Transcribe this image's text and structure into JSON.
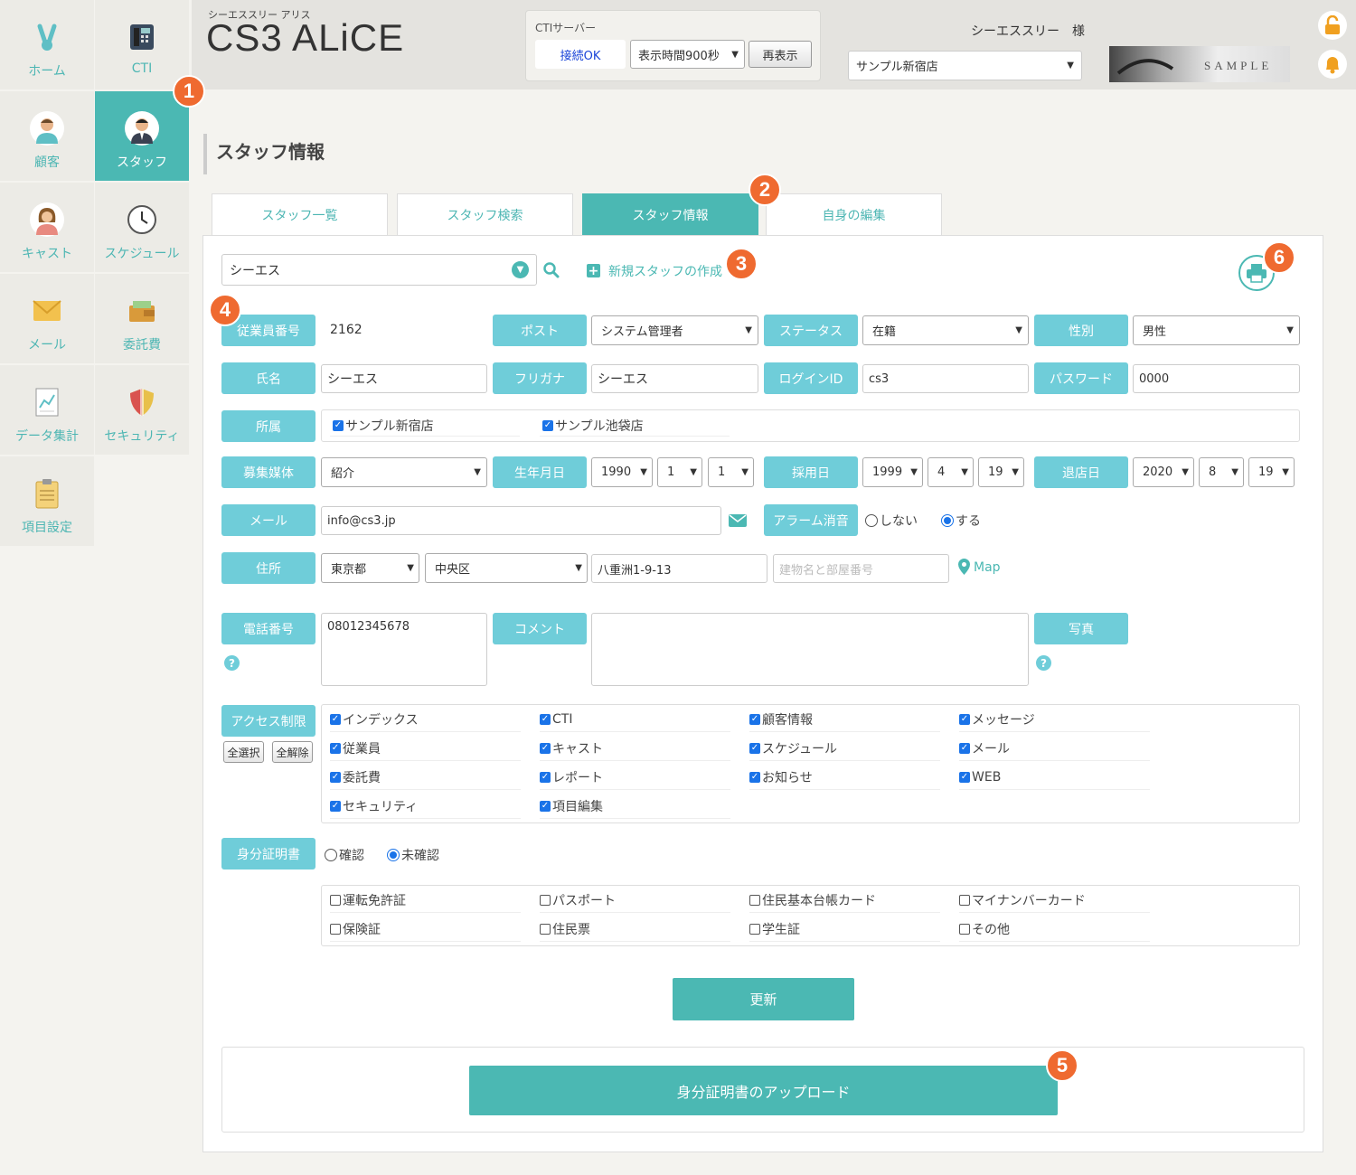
{
  "app": {
    "subtitle": "シーエススリー アリス",
    "title": "CS3 ALiCE"
  },
  "header": {
    "cti_label": "CTIサーバー",
    "cti_status": "接続OK",
    "display_time": "表示時間900秒",
    "refresh_label": "再表示",
    "user_name": "シーエススリー　様",
    "store": "サンプル新宿店"
  },
  "sidebar": {
    "items": [
      {
        "label": "ホーム"
      },
      {
        "label": "CTI"
      },
      {
        "label": "顧客"
      },
      {
        "label": "スタッフ"
      },
      {
        "label": "キャスト"
      },
      {
        "label": "スケジュール"
      },
      {
        "label": "メール"
      },
      {
        "label": "委託費"
      },
      {
        "label": "データ集計"
      },
      {
        "label": "セキュリティ"
      },
      {
        "label": "項目設定"
      }
    ]
  },
  "badges": [
    "1",
    "2",
    "3",
    "4",
    "5",
    "6"
  ],
  "page_title": "スタッフ情報",
  "tabs": [
    "スタッフ一覧",
    "スタッフ検索",
    "スタッフ情報",
    "自身の編集"
  ],
  "search": {
    "value": "シーエス",
    "new_staff": "新規スタッフの作成"
  },
  "form": {
    "employee_no_label": "従業員番号",
    "employee_no": "2162",
    "post_label": "ポスト",
    "post": "システム管理者",
    "status_label": "ステータス",
    "status": "在籍",
    "gender_label": "性別",
    "gender": "男性",
    "name_label": "氏名",
    "name": "シーエス",
    "furigana_label": "フリガナ",
    "furigana": "シーエス",
    "login_label": "ログインID",
    "login": "cs3",
    "password_label": "パスワード",
    "password": "0000",
    "affiliation_label": "所属",
    "aff1": "サンプル新宿店",
    "aff2": "サンプル池袋店",
    "media_label": "募集媒体",
    "media": "紹介",
    "birth_label": "生年月日",
    "birth_y": "1990",
    "birth_m": "1",
    "birth_d": "1",
    "hire_label": "採用日",
    "hire_y": "1999",
    "hire_m": "4",
    "hire_d": "19",
    "leave_label": "退店日",
    "leave_y": "2020",
    "leave_m": "8",
    "leave_d": "19",
    "mail_label": "メール",
    "mail": "info@cs3.jp",
    "alarm_label": "アラーム消音",
    "alarm_no": "しない",
    "alarm_yes": "する",
    "address_label": "住所",
    "pref": "東京都",
    "ward": "中央区",
    "street": "八重洲1-9-13",
    "building_placeholder": "建物名と部屋番号",
    "map": "Map",
    "phone_label": "電話番号",
    "phone": "08012345678",
    "comment_label": "コメント",
    "photo_label": "写真",
    "access_label": "アクセス制限",
    "select_all": "全選択",
    "deselect_all": "全解除",
    "access": [
      "インデックス",
      "CTI",
      "顧客情報",
      "メッセージ",
      "従業員",
      "キャスト",
      "スケジュール",
      "メール",
      "委託費",
      "レポート",
      "お知らせ",
      "WEB",
      "セキュリティ",
      "項目編集"
    ],
    "id_label": "身分証明書",
    "id_confirmed": "確認",
    "id_unconfirmed": "未確認",
    "id_docs": [
      "運転免許証",
      "パスポート",
      "住民基本台帳カード",
      "マイナンバーカード",
      "保険証",
      "住民票",
      "学生証",
      "その他"
    ],
    "update": "更新",
    "upload": "身分証明書のアップロード"
  },
  "colors": {
    "accent": "#4bb8b3",
    "label": "#6fcdd9",
    "badge": "#ef6a30"
  }
}
